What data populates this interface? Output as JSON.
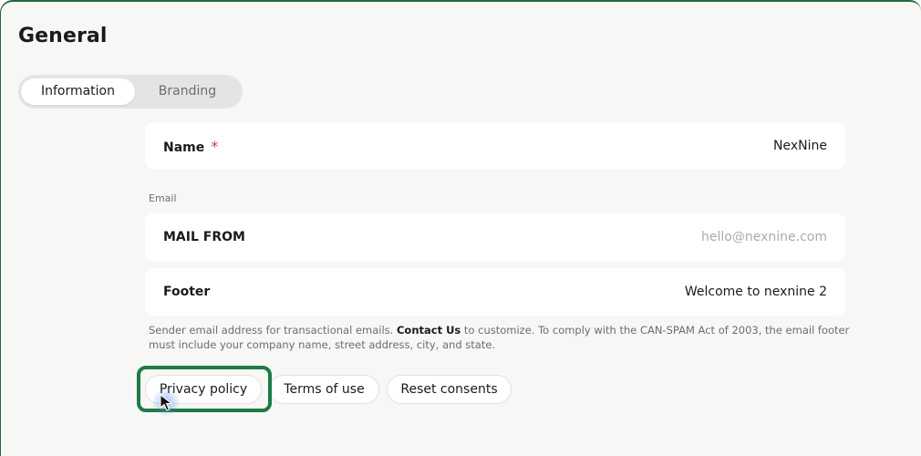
{
  "page": {
    "title": "General"
  },
  "tabs": [
    {
      "label": "Information",
      "active": true
    },
    {
      "label": "Branding",
      "active": false
    }
  ],
  "fields": {
    "name": {
      "label": "Name",
      "required_mark": "*",
      "value": "NexNine"
    },
    "email_section_label": "Email",
    "mail_from": {
      "label": "MAIL FROM",
      "placeholder": "hello@nexnine.com"
    },
    "footer": {
      "label": "Footer",
      "value": "Welcome to nexnine 2"
    }
  },
  "help": {
    "before_link": "Sender email address for transactional emails. ",
    "link": "Contact Us",
    "after_link": " to customize. To comply with the CAN-SPAM Act of 2003, the email footer must include your company name, street address, city, and state."
  },
  "buttons": {
    "privacy": "Privacy policy",
    "terms": "Terms of use",
    "reset": "Reset consents"
  },
  "colors": {
    "accent": "#1f7a45",
    "required": "#d9363e",
    "background": "#f7f7f6"
  }
}
